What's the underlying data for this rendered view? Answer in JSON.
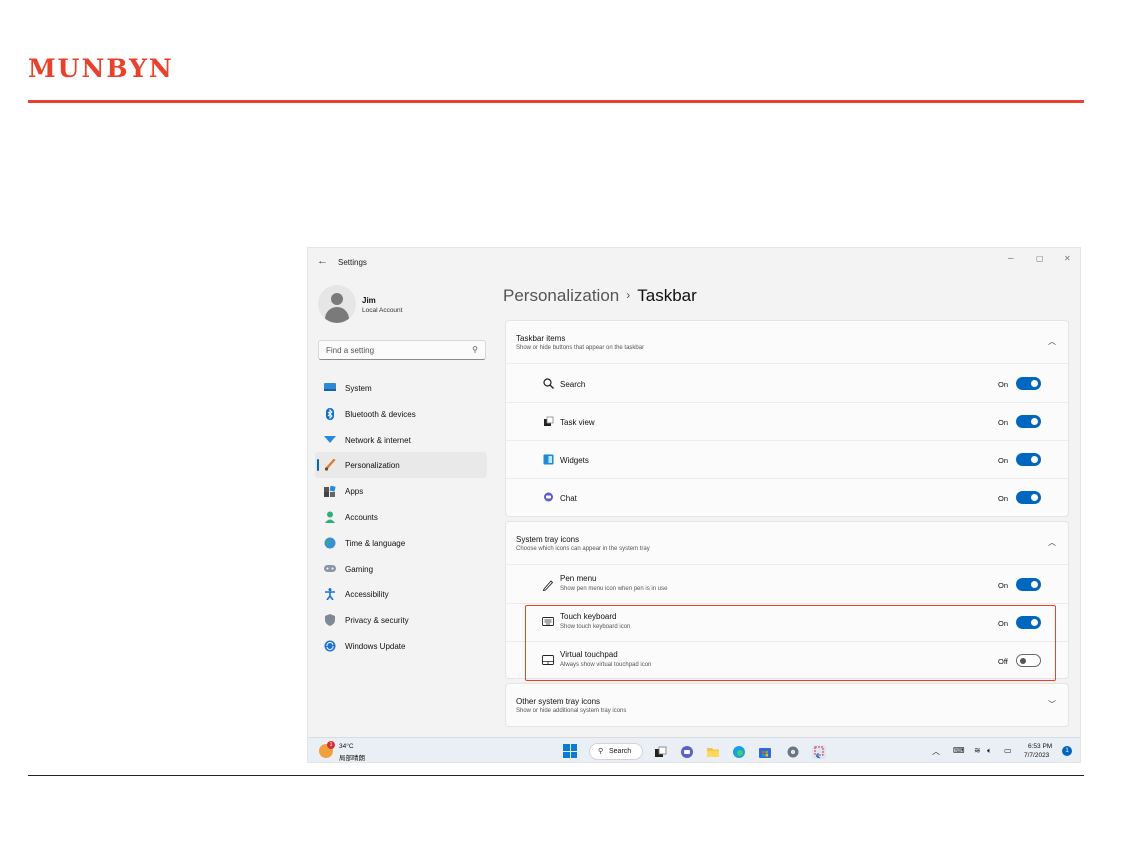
{
  "brand": {
    "logo_text": "MUNBYN",
    "color": "#e8412c"
  },
  "window": {
    "title": "Settings",
    "back_icon": "back-arrow-icon",
    "controls": {
      "minimize": "–",
      "maximize": "▢",
      "close": "✕"
    }
  },
  "user": {
    "name": "Jim",
    "account_type": "Local Account"
  },
  "search": {
    "placeholder": "Find a setting",
    "icon": "search-icon"
  },
  "nav": {
    "items": [
      {
        "label": "System",
        "icon": "system-icon",
        "active": false
      },
      {
        "label": "Bluetooth & devices",
        "icon": "bluetooth-icon",
        "active": false
      },
      {
        "label": "Network & internet",
        "icon": "network-icon",
        "active": false
      },
      {
        "label": "Personalization",
        "icon": "brush-icon",
        "active": true
      },
      {
        "label": "Apps",
        "icon": "apps-icon",
        "active": false
      },
      {
        "label": "Accounts",
        "icon": "accounts-icon",
        "active": false
      },
      {
        "label": "Time & language",
        "icon": "globe-icon",
        "active": false
      },
      {
        "label": "Gaming",
        "icon": "gamepad-icon",
        "active": false
      },
      {
        "label": "Accessibility",
        "icon": "accessibility-icon",
        "active": false
      },
      {
        "label": "Privacy & security",
        "icon": "shield-icon",
        "active": false
      },
      {
        "label": "Windows Update",
        "icon": "update-icon",
        "active": false
      }
    ]
  },
  "breadcrumb": {
    "parent": "Personalization",
    "separator": "›",
    "current": "Taskbar"
  },
  "sections": {
    "taskbar_items": {
      "title": "Taskbar items",
      "subtitle": "Show or hide buttons that appear on the taskbar",
      "expanded": true,
      "rows": [
        {
          "label": "Search",
          "state": "On",
          "on": true
        },
        {
          "label": "Task view",
          "state": "On",
          "on": true
        },
        {
          "label": "Widgets",
          "state": "On",
          "on": true
        },
        {
          "label": "Chat",
          "state": "On",
          "on": true
        }
      ]
    },
    "system_tray": {
      "title": "System tray icons",
      "subtitle": "Choose which icons can appear in the system tray",
      "expanded": true,
      "rows": [
        {
          "label": "Pen menu",
          "sub": "Show pen menu icon when pen is in use",
          "state": "On",
          "on": true
        },
        {
          "label": "Touch keyboard",
          "sub": "Show touch keyboard icon",
          "state": "On",
          "on": true
        },
        {
          "label": "Virtual touchpad",
          "sub": "Always show virtual touchpad icon",
          "state": "Off",
          "on": false
        }
      ]
    },
    "other_tray": {
      "title": "Other system tray icons",
      "subtitle": "Show or hide additional system tray icons",
      "expanded": false
    }
  },
  "taskbar": {
    "weather": {
      "badge": "1",
      "temp": "34°C",
      "desc": "局部晴朗"
    },
    "search_label": "Search",
    "clock": {
      "time": "6:53 PM",
      "date": "7/7/2023"
    },
    "notification_count": "1"
  },
  "colors": {
    "accent": "#0067c0",
    "highlight": "#e8412c"
  }
}
